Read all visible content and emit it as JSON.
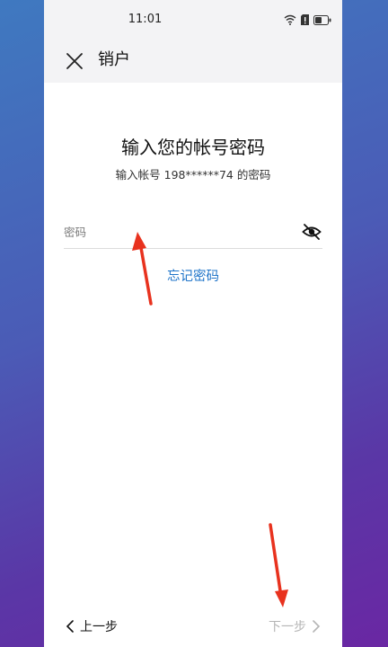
{
  "status_bar": {
    "time": "11:01"
  },
  "header": {
    "title": "销户",
    "close_icon": "close-icon"
  },
  "main": {
    "title": "输入您的帐号密码",
    "subtitle": "输入帐号 198******74 的密码",
    "password": {
      "value": "",
      "placeholder": "密码",
      "visibility_icon": "eye-off-icon"
    },
    "forgot_link": "忘记密码"
  },
  "footer": {
    "prev_label": "上一步",
    "next_label": "下一步"
  },
  "colors": {
    "accent": "#1f74c9",
    "annotation": "#e8321e",
    "disabled_text": "#b5b5b5"
  }
}
